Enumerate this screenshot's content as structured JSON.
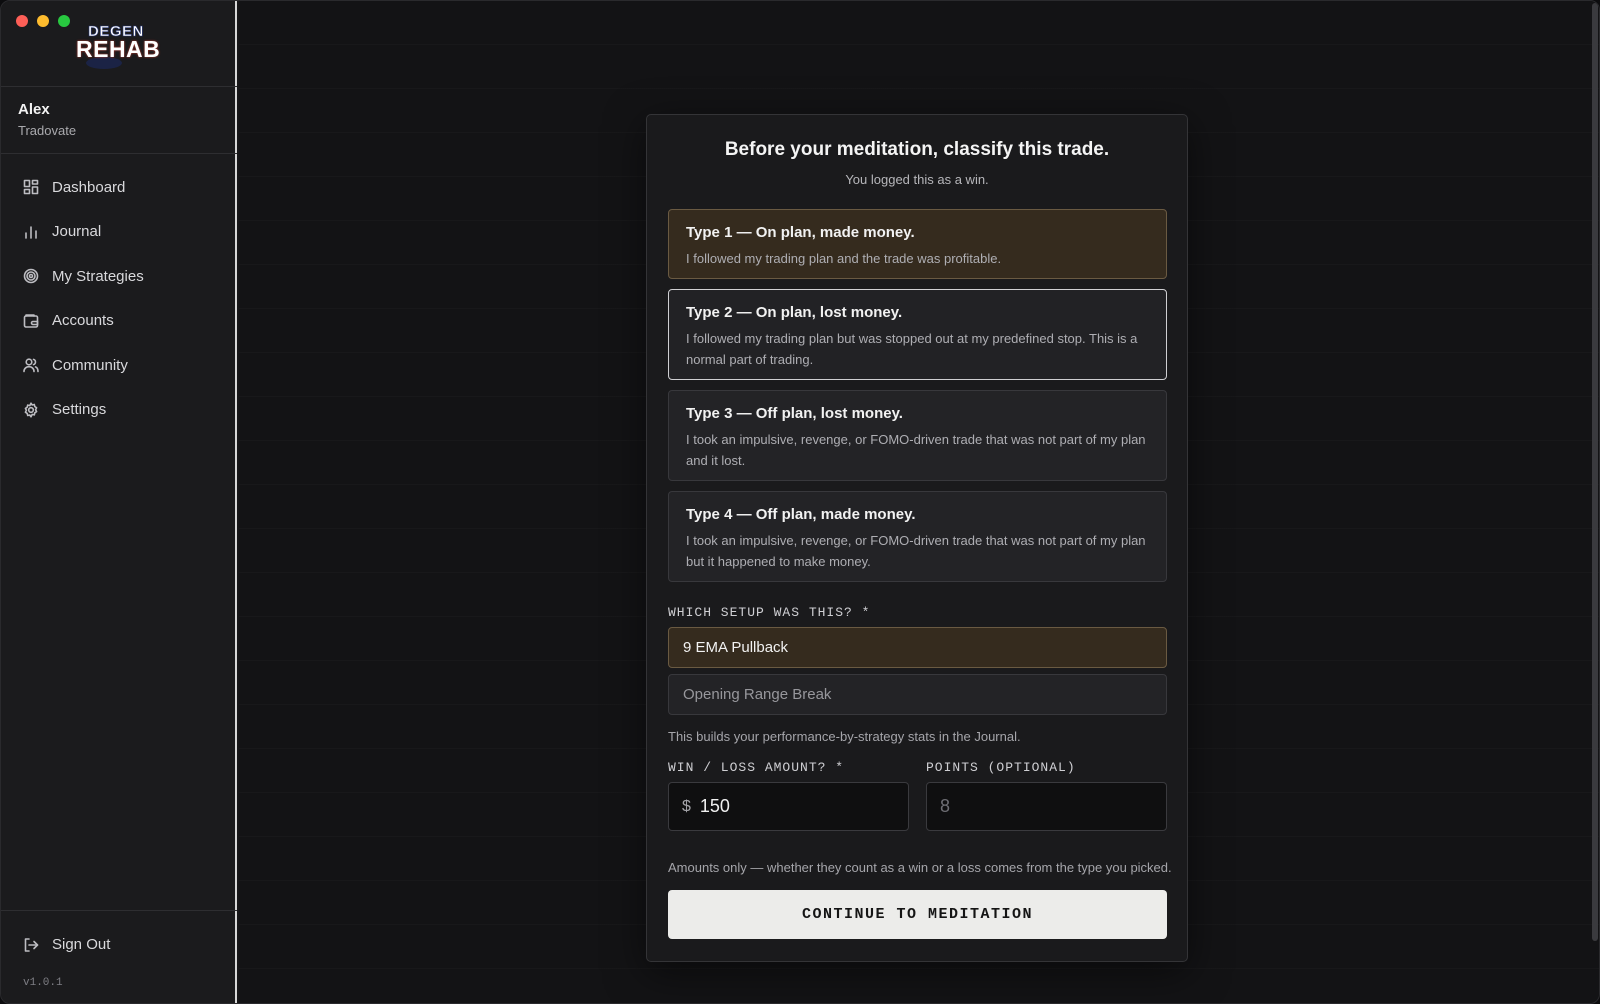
{
  "window": {
    "controls": [
      "close",
      "minimize",
      "zoom"
    ]
  },
  "brand": {
    "logo_top": "DEGEN",
    "logo_bottom": "REHAB"
  },
  "user": {
    "name": "Alex",
    "broker": "Tradovate"
  },
  "sidebar": {
    "items": [
      {
        "label": "Dashboard",
        "icon": "grid-icon"
      },
      {
        "label": "Journal",
        "icon": "bar-chart-icon"
      },
      {
        "label": "My Strategies",
        "icon": "target-icon"
      },
      {
        "label": "Accounts",
        "icon": "wallet-icon"
      },
      {
        "label": "Community",
        "icon": "users-icon"
      },
      {
        "label": "Settings",
        "icon": "gear-icon"
      }
    ],
    "sign_out": "Sign Out",
    "version": "v1.0.1"
  },
  "modal": {
    "title": "Before your meditation, classify this trade.",
    "subtitle": "You logged this as a win.",
    "options": [
      {
        "title": "Type 1 — On plan, made money.",
        "desc": "I followed my trading plan and the trade was profitable.",
        "state": "selected"
      },
      {
        "title": "Type 2 — On plan, lost money.",
        "desc": "I followed my trading plan but was stopped out at my predefined stop. This is a normal part of trading.",
        "state": "focused"
      },
      {
        "title": "Type 3 — Off plan, lost money.",
        "desc": "I took an impulsive, revenge, or FOMO-driven trade that was not part of my plan and it lost.",
        "state": "default"
      },
      {
        "title": "Type 4 — Off plan, made money.",
        "desc": "I took an impulsive, revenge, or FOMO-driven trade that was not part of my plan but it happened to make money.",
        "state": "default"
      }
    ],
    "setup_label": "WHICH SETUP WAS THIS? *",
    "setups": [
      {
        "label": "9 EMA Pullback",
        "selected": true
      },
      {
        "label": "Opening Range Break",
        "selected": false
      }
    ],
    "setup_hint": "This builds your performance-by-strategy stats in the Journal.",
    "amount_label": "WIN / LOSS AMOUNT? *",
    "currency_symbol": "$",
    "amount_value": "150",
    "points_label": "POINTS (OPTIONAL)",
    "points_placeholder": "8",
    "amount_hint": "Amounts only — whether they count as a win or a loss comes from the type you picked.",
    "cta": "CONTINUE TO MEDITATION"
  },
  "colors": {
    "selected_bg": "#352b1e",
    "selected_border": "#6a5a42",
    "cta_bg": "#ececea",
    "sidebar_bg": "#1b1b1d",
    "main_bg": "#131315"
  }
}
